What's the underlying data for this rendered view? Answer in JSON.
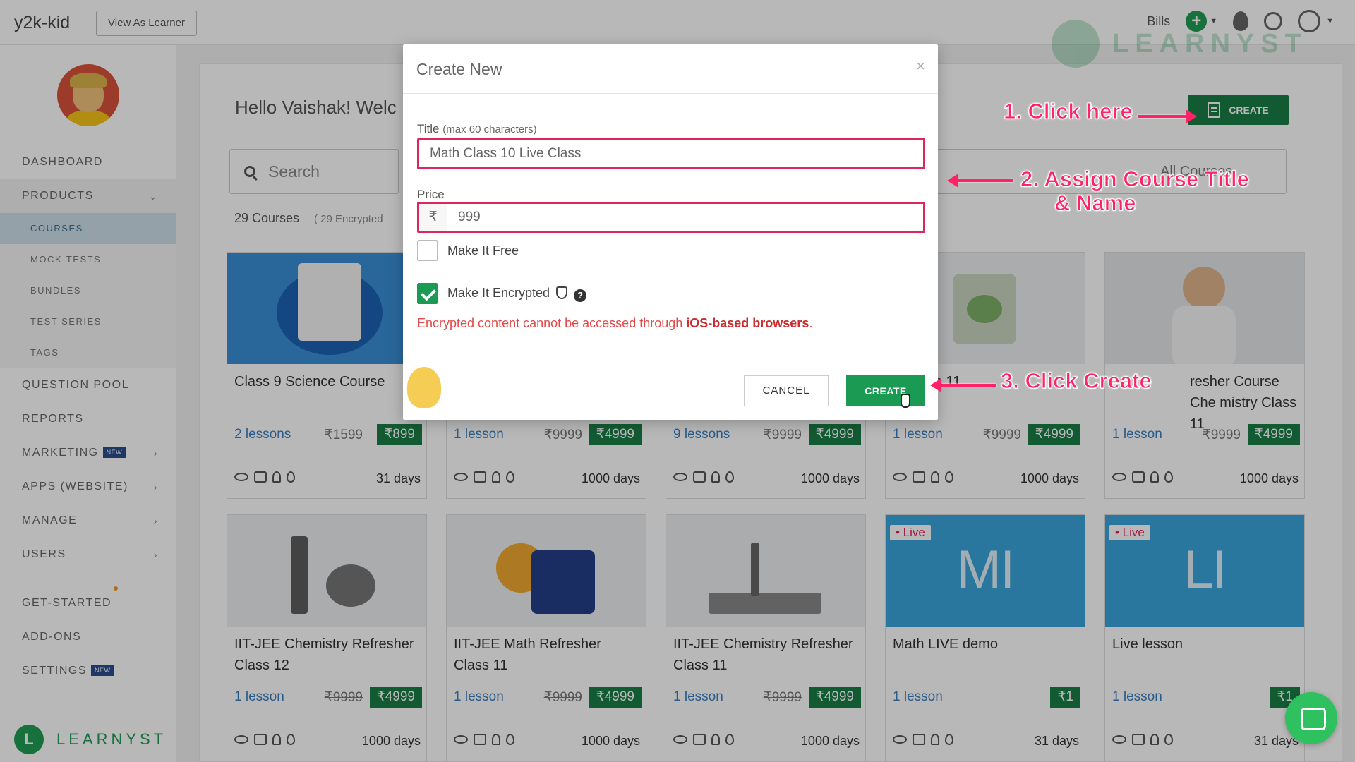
{
  "topbar": {
    "brand": "y2k-kid",
    "view_as_learner": "View As Learner",
    "bills": "Bills"
  },
  "sidebar": {
    "items": [
      {
        "label": "DASHBOARD"
      },
      {
        "label": "PRODUCTS"
      },
      {
        "label": "COURSES"
      },
      {
        "label": "MOCK-TESTS"
      },
      {
        "label": "BUNDLES"
      },
      {
        "label": "TEST SERIES"
      },
      {
        "label": "TAGS"
      },
      {
        "label": "QUESTION POOL"
      },
      {
        "label": "REPORTS"
      },
      {
        "label": "MARKETING",
        "badge": "NEW"
      },
      {
        "label": "APPS (WEBSITE)"
      },
      {
        "label": "MANAGE"
      },
      {
        "label": "USERS"
      },
      {
        "label": "GET-STARTED"
      },
      {
        "label": "ADD-ONS"
      },
      {
        "label": "SETTINGS",
        "badge": "NEW"
      }
    ],
    "footer_brand": "LEARNYST"
  },
  "main": {
    "greeting": "Hello Vaishak! Welc",
    "search_placeholder": "Search",
    "filter_label": "All Courses",
    "course_count": "29 Courses",
    "encrypted_count": "( 29 Encrypted",
    "create_label": "CREATE"
  },
  "cards": [
    {
      "title": "Class 9 Science Course",
      "lessons": "2 lessons",
      "old_price": "₹1599",
      "price": "₹899",
      "days": "31 days",
      "live": ""
    },
    {
      "title": "",
      "lessons": "1 lesson",
      "old_price": "₹9999",
      "price": "₹4999",
      "days": "1000 days",
      "live": ""
    },
    {
      "title": "",
      "lessons": "9 lessons",
      "old_price": "₹9999",
      "price": "₹4999",
      "days": "1000 days",
      "live": ""
    },
    {
      "title": "s 11",
      "lessons": "1 lesson",
      "old_price": "₹9999",
      "price": "₹4999",
      "days": "1000 days",
      "live": ""
    },
    {
      "title": "resher Course Che mistry Class 11",
      "lessons": "1 lesson",
      "old_price": "₹9999",
      "price": "₹4999",
      "days": "1000 days",
      "live": ""
    },
    {
      "title": "IIT-JEE Chemistry Refresher Class 12",
      "lessons": "1 lesson",
      "old_price": "₹9999",
      "price": "₹4999",
      "days": "1000 days",
      "live": ""
    },
    {
      "title": "IIT-JEE Math Refresher Class 11",
      "lessons": "1 lesson",
      "old_price": "₹9999",
      "price": "₹4999",
      "days": "1000 days",
      "live": ""
    },
    {
      "title": "IIT-JEE Chemistry Refresher Class 11",
      "lessons": "1 lesson",
      "old_price": "₹9999",
      "price": "₹4999",
      "days": "1000 days",
      "live": ""
    },
    {
      "title": "Math LIVE demo",
      "lessons": "1 lesson",
      "old_price": "",
      "price": "₹1",
      "days": "31 days",
      "live": "• Live",
      "letters": "MI"
    },
    {
      "title": "Live lesson",
      "lessons": "1 lesson",
      "old_price": "",
      "price": "₹1",
      "days": "31 days",
      "live": "• Live",
      "letters": "LI"
    }
  ],
  "modal": {
    "title": "Create New",
    "close": "×",
    "title_label": "Title",
    "title_hint": "(max 60 characters)",
    "title_value": "Math Class 10 Live Class",
    "price_label": "Price",
    "currency": "₹",
    "price_value": "999",
    "free_label": "Make It Free",
    "encrypted_label": "Make It Encrypted",
    "warning_prefix": "Encrypted content cannot be accessed through ",
    "warning_emph": "iOS-based browsers",
    "warning_suffix": ".",
    "cancel": "CANCEL",
    "create": "CREATE"
  },
  "annotations": {
    "step1": "1. Click here",
    "step2_line1": "2. Assign Course Title",
    "step2_line2": "& Name",
    "step3": "3. Click Create"
  },
  "colors": {
    "accent_green": "#1a9a52",
    "annotation_pink": "#ff2266",
    "live_blue": "#3aa5dd"
  }
}
